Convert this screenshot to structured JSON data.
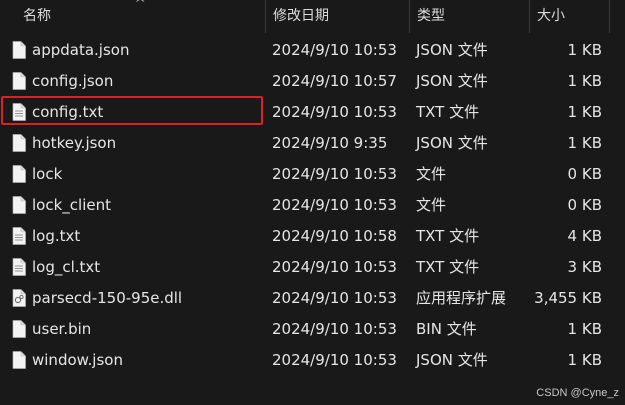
{
  "columns": {
    "name": "名称",
    "date": "修改日期",
    "type": "类型",
    "size": "大小"
  },
  "files": [
    {
      "name": "appdata.json",
      "date": "2024/9/10 10:53",
      "type": "JSON 文件",
      "size": "1 KB",
      "icon": "document-icon"
    },
    {
      "name": "config.json",
      "date": "2024/9/10 10:57",
      "type": "JSON 文件",
      "size": "1 KB",
      "icon": "document-icon"
    },
    {
      "name": "config.txt",
      "date": "2024/9/10 10:53",
      "type": "TXT 文件",
      "size": "1 KB",
      "icon": "text-document-icon"
    },
    {
      "name": "hotkey.json",
      "date": "2024/9/10 9:35",
      "type": "JSON 文件",
      "size": "1 KB",
      "icon": "document-icon"
    },
    {
      "name": "lock",
      "date": "2024/9/10 10:53",
      "type": "文件",
      "size": "0 KB",
      "icon": "document-icon"
    },
    {
      "name": "lock_client",
      "date": "2024/9/10 10:53",
      "type": "文件",
      "size": "0 KB",
      "icon": "document-icon"
    },
    {
      "name": "log.txt",
      "date": "2024/9/10 10:58",
      "type": "TXT 文件",
      "size": "4 KB",
      "icon": "text-document-icon"
    },
    {
      "name": "log_cl.txt",
      "date": "2024/9/10 10:53",
      "type": "TXT 文件",
      "size": "3 KB",
      "icon": "text-document-icon"
    },
    {
      "name": "parsecd-150-95e.dll",
      "date": "2024/9/10 10:53",
      "type": "应用程序扩展",
      "size": "3,455 KB",
      "icon": "dll-file-icon"
    },
    {
      "name": "user.bin",
      "date": "2024/9/10 10:53",
      "type": "BIN 文件",
      "size": "1 KB",
      "icon": "document-icon"
    },
    {
      "name": "window.json",
      "date": "2024/9/10 10:53",
      "type": "JSON 文件",
      "size": "1 KB",
      "icon": "document-icon"
    }
  ],
  "highlighted_file": "config.txt",
  "highlight_color": "#e21f1f",
  "watermark": "CSDN @Cyne_z"
}
